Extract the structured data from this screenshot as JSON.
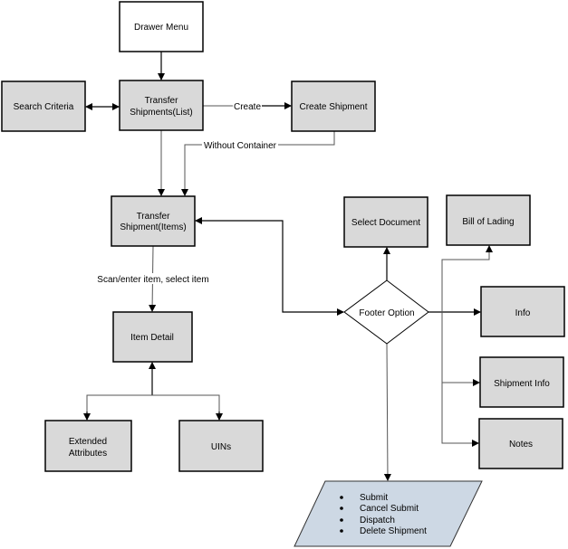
{
  "colors": {
    "box_fill": "#d9d9d9",
    "start_fill": "#ffffff",
    "output_fill": "#cdd8e4",
    "line": "#555555"
  },
  "nodes": {
    "drawer_menu": "Drawer Menu",
    "search_criteria": "Search Criteria",
    "transfer_list": [
      "Transfer",
      "Shipments(List)"
    ],
    "create_shipment": "Create Shipment",
    "transfer_items": [
      "Transfer",
      "Shipment(Items)"
    ],
    "item_detail": "Item Detail",
    "extended_attributes": [
      "Extended",
      "Attributes"
    ],
    "uins": "UINs",
    "select_document": "Select Document",
    "bill_of_lading": "Bill of Lading",
    "info": "Info",
    "shipment_info": "Shipment Info",
    "notes": "Notes",
    "footer_option": "Footer Option",
    "actions": [
      "Submit",
      "Cancel Submit",
      "Dispatch",
      "Delete Shipment"
    ]
  },
  "edge_labels": {
    "create": "Create",
    "without_container": "Without Container",
    "scan_enter": "Scan/enter item, select item"
  }
}
